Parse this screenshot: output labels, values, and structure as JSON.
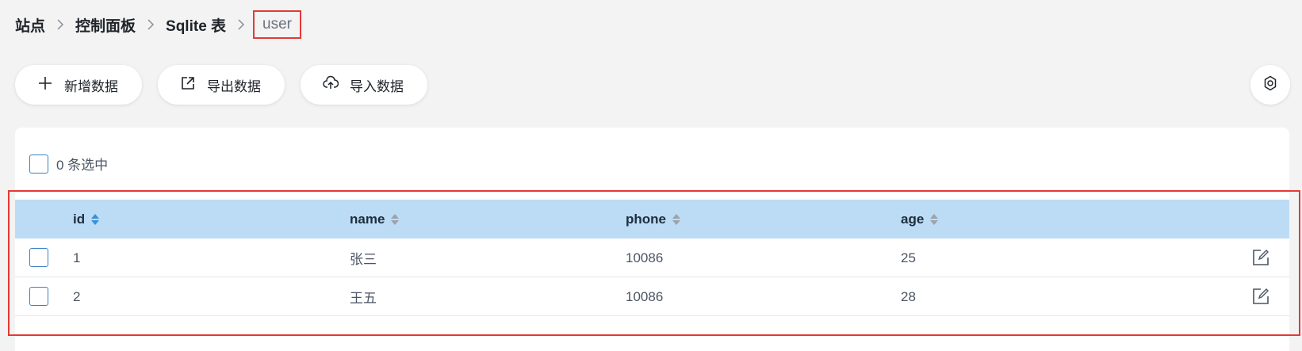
{
  "breadcrumb": {
    "items": [
      "站点",
      "控制面板",
      "Sqlite 表"
    ],
    "current": "user"
  },
  "toolbar": {
    "add_label": "新增数据",
    "export_label": "导出数据",
    "import_label": "导入数据"
  },
  "selection": {
    "label": "0 条选中"
  },
  "table": {
    "columns": [
      "id",
      "name",
      "phone",
      "age"
    ],
    "rows": [
      {
        "id": "1",
        "name": "张三",
        "phone": "10086",
        "age": "25"
      },
      {
        "id": "2",
        "name": "王五",
        "phone": "10086",
        "age": "28"
      }
    ]
  },
  "colors": {
    "header_bg": "#bcdcf5",
    "accent": "#3b82c4",
    "highlight_border": "#e53935",
    "page_bg": "#f2f3f2"
  },
  "icons": {
    "add": "plus-icon",
    "export": "export-icon",
    "import": "cloud-upload-icon",
    "settings": "gear-icon",
    "edit": "edit-icon",
    "sort": "sort-icon"
  }
}
